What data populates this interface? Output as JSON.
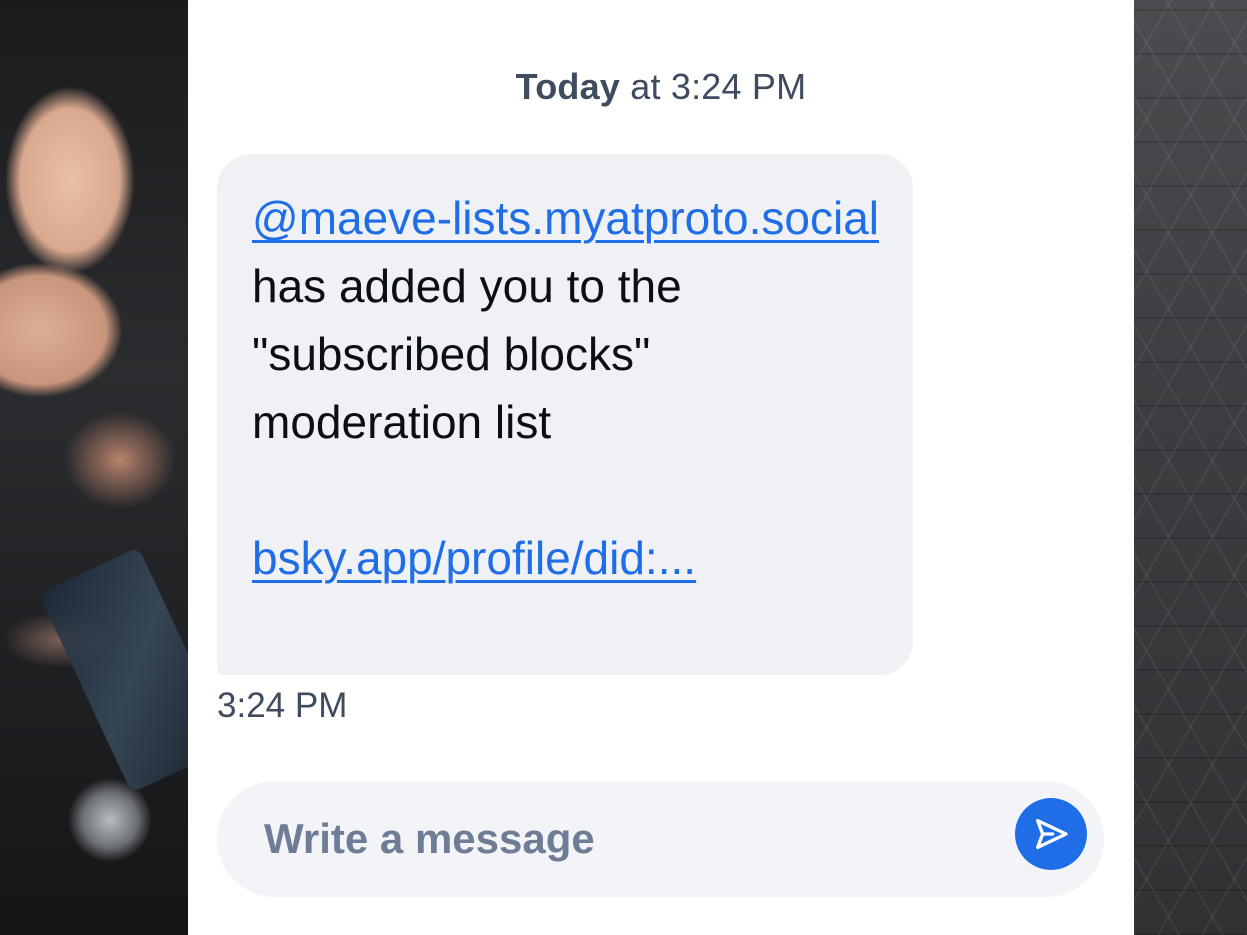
{
  "date_header": {
    "day": "Today",
    "time": "at 3:24 PM"
  },
  "message": {
    "handle": "@maeve-lists.myatproto.social",
    "text_line": "has added you to the \"subscribed blocks\" moderation list",
    "link": "bsky.app/profile/did:...",
    "bubble_color": "#f0f1f5",
    "link_color": "#1f6ee8"
  },
  "message_time": "3:24 PM",
  "composer": {
    "placeholder": "Write a message",
    "send_icon": "send-arrow-icon",
    "accent": "#1f6ee8"
  }
}
